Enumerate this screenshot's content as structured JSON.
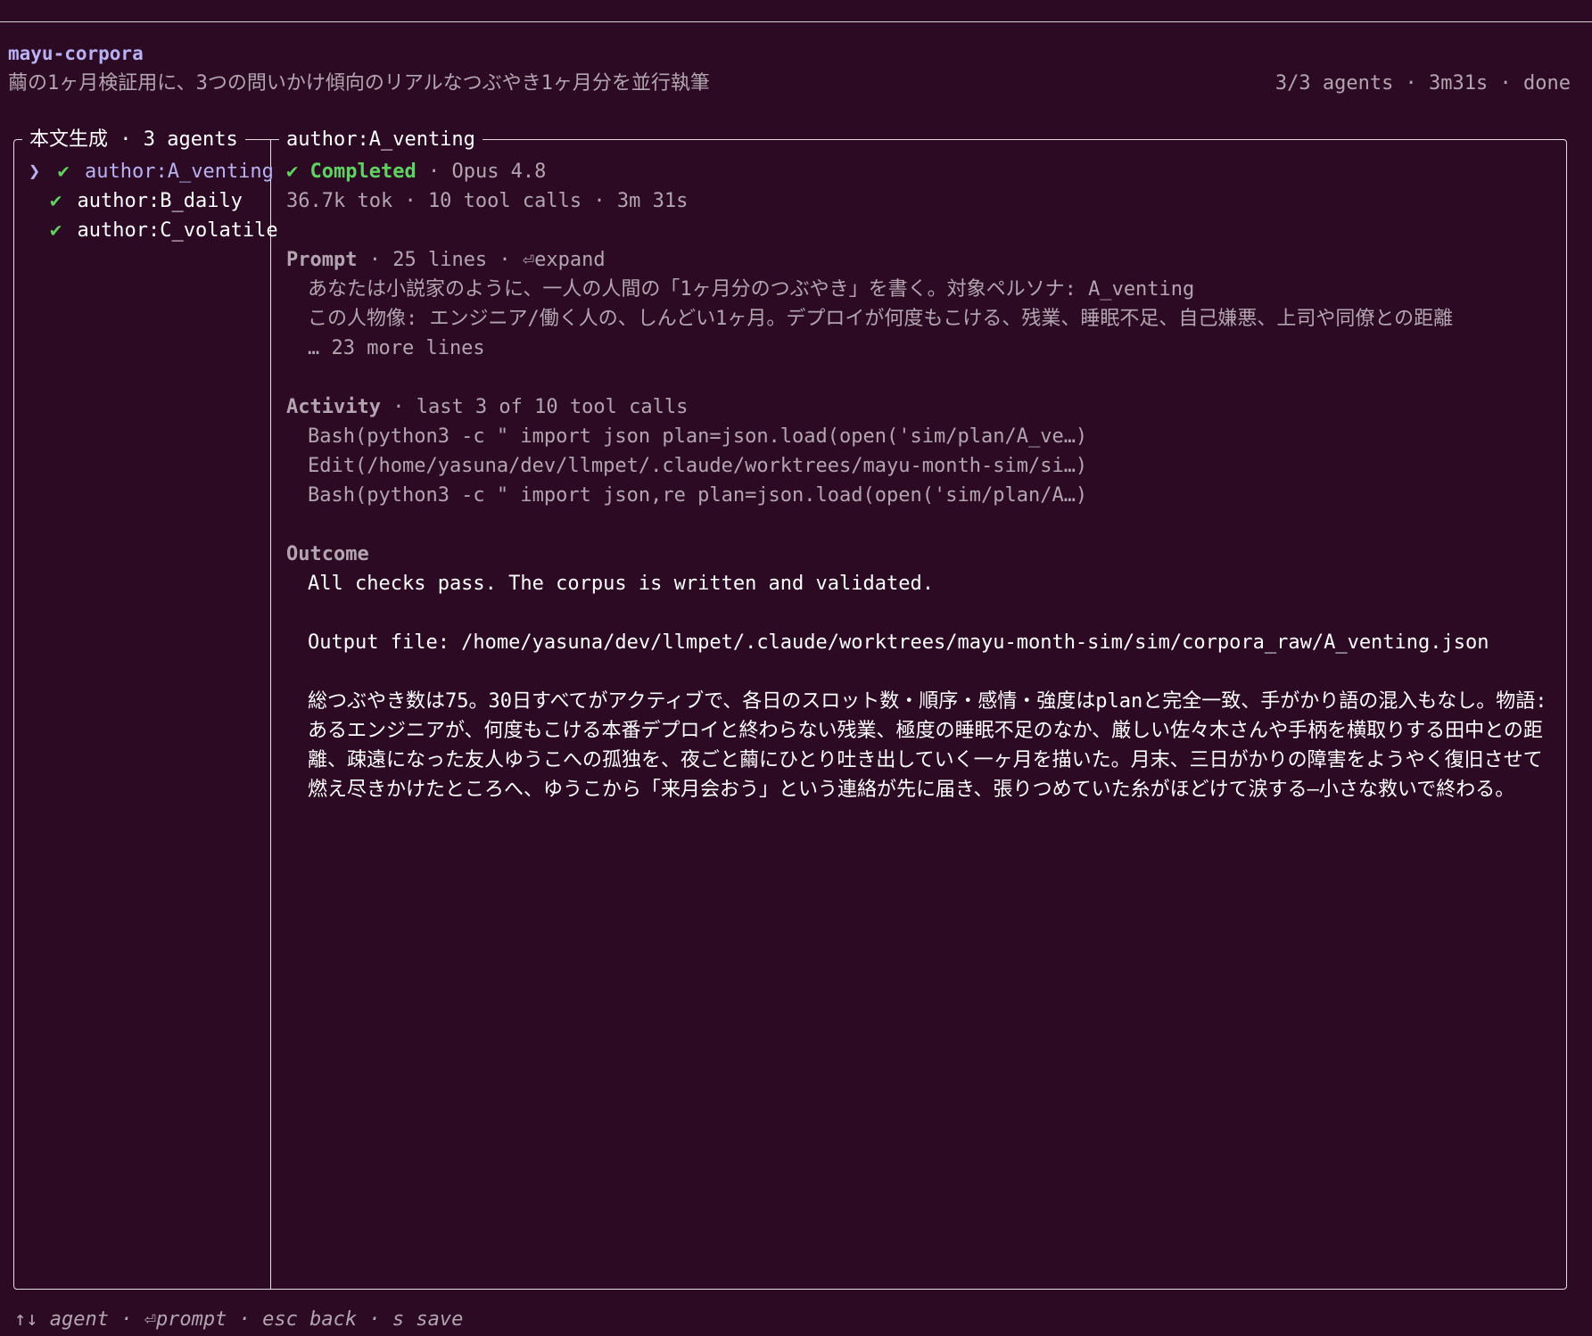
{
  "app": {
    "name": "mayu-corpora",
    "subtitle": "繭の1ヶ月検証用に、3つの問いかけ傾向のリアルなつぶやき1ヶ月分を並行執筆",
    "status": "3/3 agents · 3m31s · done"
  },
  "agent_list": {
    "title": "本文生成 · 3 agents",
    "caret": "❯",
    "check": "✔",
    "items": [
      {
        "label": "author:A_venting",
        "selected": true
      },
      {
        "label": "author:B_daily",
        "selected": false
      },
      {
        "label": "author:C_volatile",
        "selected": false
      }
    ]
  },
  "detail": {
    "title": "author:A_venting",
    "status_check": "✔",
    "status_label": "Completed",
    "model": " · Opus 4.8",
    "stats": "36.7k tok · 10 tool calls · 3m 31s",
    "prompt": {
      "label": "Prompt",
      "meta": " · 25 lines · ⏎expand",
      "lines": [
        "あなたは小説家のように、一人の人間の「1ヶ月分のつぶやき」を書く。対象ペルソナ: A_venting",
        "この人物像: エンジニア/働く人の、しんどい1ヶ月。デプロイが何度もこける、残業、睡眠不足、自己嫌悪、上司や同僚との距離",
        "… 23 more lines"
      ]
    },
    "activity": {
      "label": "Activity",
      "meta": " · last 3 of 10 tool calls",
      "calls": [
        "Bash(python3 -c \" import json plan=json.load(open('sim/plan/A_ve…)",
        "Edit(/home/yasuna/dev/llmpet/.claude/worktrees/mayu-month-sim/si…)",
        "Bash(python3 -c \" import json,re plan=json.load(open('sim/plan/A…)"
      ]
    },
    "outcome": {
      "label": "Outcome",
      "summary": "All checks pass. The corpus is written and validated.",
      "output_file": "Output file: /home/yasuna/dev/llmpet/.claude/worktrees/mayu-month-sim/sim/corpora_raw/A_venting.json",
      "body": "総つぶやき数は75。30日すべてがアクティブで、各日のスロット数・順序・感情・強度はplanと完全一致、手がかり語の混入もなし。物語: あるエンジニアが、何度もこける本番デプロイと終わらない残業、極度の睡眠不足のなか、厳しい佐々木さんや手柄を横取りする田中との距離、疎遠になった友人ゆうこへの孤独を、夜ごと繭にひとり吐き出していく一ヶ月を描いた。月末、三日がかりの障害をようやく復旧させて燃え尽きかけたところへ、ゆうこから「来月会おう」という連絡が先に届き、張りつめていた糸がほどけて涙する—小さな救いで終わる。"
    }
  },
  "footer": "↑↓ agent · ⏎prompt · esc back · s save"
}
